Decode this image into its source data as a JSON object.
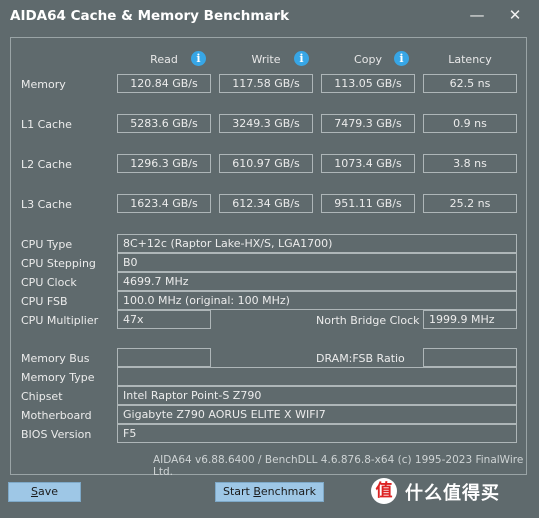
{
  "window": {
    "title": "AIDA64 Cache & Memory Benchmark",
    "minimize_glyph": "—",
    "close_glyph": "✕"
  },
  "headers": {
    "read": "Read",
    "write": "Write",
    "copy": "Copy",
    "latency": "Latency"
  },
  "info_glyph": "i",
  "bench": [
    {
      "label": "Memory",
      "read": "120.84 GB/s",
      "write": "117.58 GB/s",
      "copy": "113.05 GB/s",
      "latency": "62.5 ns"
    },
    {
      "label": "L1 Cache",
      "read": "5283.6 GB/s",
      "write": "3249.3 GB/s",
      "copy": "7479.3 GB/s",
      "latency": "0.9 ns"
    },
    {
      "label": "L2 Cache",
      "read": "1296.3 GB/s",
      "write": "610.97 GB/s",
      "copy": "1073.4 GB/s",
      "latency": "3.8 ns"
    },
    {
      "label": "L3 Cache",
      "read": "1623.4 GB/s",
      "write": "612.34 GB/s",
      "copy": "951.11 GB/s",
      "latency": "25.2 ns"
    }
  ],
  "cpu": {
    "type_label": "CPU Type",
    "type_value": "8C+12c  (Raptor Lake-HX/S, LGA1700)",
    "stepping_label": "CPU Stepping",
    "stepping_value": "B0",
    "clock_label": "CPU Clock",
    "clock_value": "4699.7 MHz",
    "fsb_label": "CPU FSB",
    "fsb_value": "100.0 MHz  (original: 100 MHz)",
    "multiplier_label": "CPU Multiplier",
    "multiplier_value": "47x",
    "nb_clock_label": "North Bridge Clock",
    "nb_clock_value": "1999.9 MHz"
  },
  "system": {
    "membus_label": "Memory Bus",
    "membus_value": "",
    "dramfsb_label": "DRAM:FSB Ratio",
    "dramfsb_value": "",
    "memtype_label": "Memory Type",
    "memtype_value": "",
    "chipset_label": "Chipset",
    "chipset_value": "Intel Raptor Point-S Z790",
    "mobo_label": "Motherboard",
    "mobo_value": "Gigabyte Z790 AORUS ELITE X WIFI7",
    "bios_label": "BIOS Version",
    "bios_value": "F5"
  },
  "footer": "AIDA64 v6.88.6400 / BenchDLL 4.6.876.8-x64  (c) 1995-2023 FinalWire Ltd.",
  "buttons": {
    "save_first": "S",
    "save_rest": "ave",
    "start_pre": "Start ",
    "start_u": "B",
    "start_post": "enchmark"
  },
  "watermark": {
    "logo": "值",
    "text": "什么值得买"
  },
  "colors": {
    "background": "#5f6a6d",
    "button": "#9ec7e6",
    "info_icon": "#37a6e6"
  }
}
